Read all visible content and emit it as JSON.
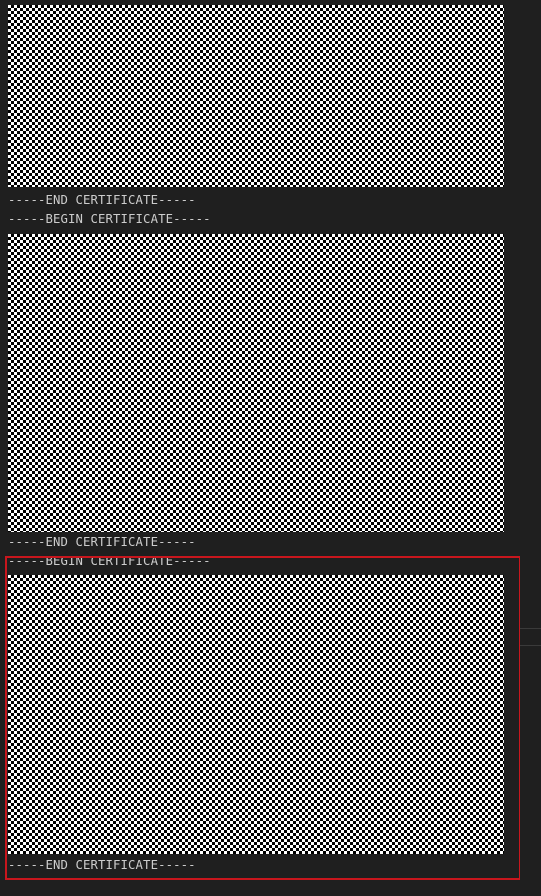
{
  "editor": {
    "lines": [
      {
        "text": "-----END CERTIFICATE-----"
      },
      {
        "text": "-----BEGIN CERTIFICATE-----"
      },
      {
        "text": "-----END CERTIFICATE-----"
      },
      {
        "text": "-----BEGIN CERTIFICATE-----"
      },
      {
        "text": "-----END CERTIFICATE-----"
      }
    ]
  },
  "colors": {
    "background": "#1f1f1f",
    "text": "#cccccc",
    "highlight_border": "#c8161d"
  }
}
